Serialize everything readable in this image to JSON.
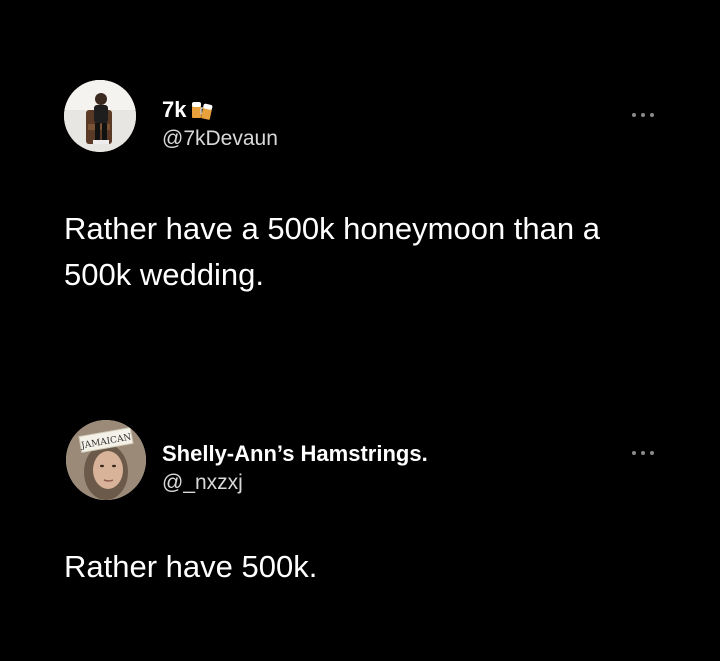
{
  "tweets": [
    {
      "display_name": "7k",
      "handle": "@7kDevaun",
      "text": "Rather have a 500k honeymoon than a 500k wedding.",
      "avatar_icon": "person-seated-avatar",
      "emoji_icon": "beer-mugs-emoji"
    },
    {
      "display_name": "Shelly-Ann’s Hamstrings.",
      "handle": "@_nxzxj",
      "text": "Rather have 500k.",
      "avatar_icon": "face-with-jamaican-sign-avatar",
      "avatar_sign_text": "JAMAICAN"
    }
  ],
  "colors": {
    "background": "#000000",
    "text": "#ffffff",
    "handle": "#d9d9d9",
    "more_dots": "#8a8a8a"
  }
}
